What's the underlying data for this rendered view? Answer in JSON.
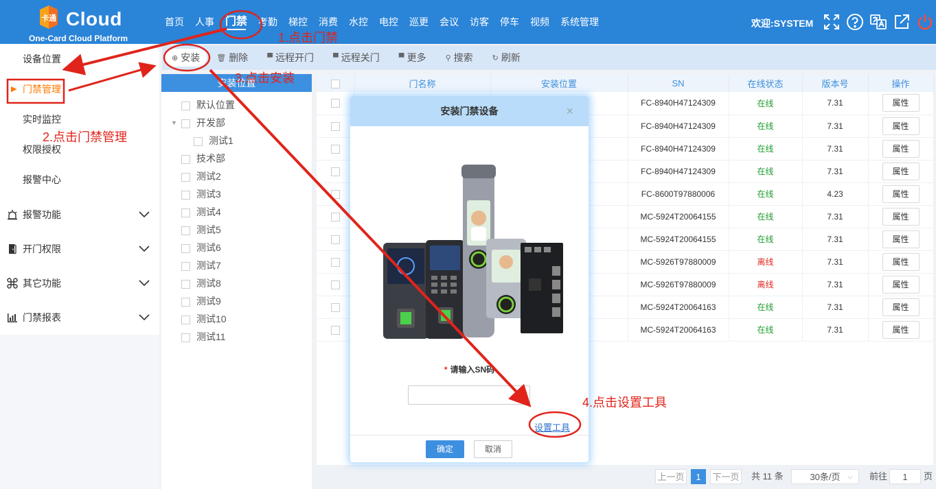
{
  "brand": {
    "word": "Cloud",
    "subtitle": "One-Card Cloud Platform",
    "mark_text": "卡通"
  },
  "nav": [
    {
      "label": "首页"
    },
    {
      "label": "人事"
    },
    {
      "label": "门禁",
      "active": true
    },
    {
      "label": "考勤"
    },
    {
      "label": "梯控"
    },
    {
      "label": "消费"
    },
    {
      "label": "水控"
    },
    {
      "label": "电控"
    },
    {
      "label": "巡更"
    },
    {
      "label": "会议"
    },
    {
      "label": "访客"
    },
    {
      "label": "停车"
    },
    {
      "label": "视频"
    },
    {
      "label": "系统管理"
    }
  ],
  "header": {
    "welcome": "欢迎:SYSTEM"
  },
  "sidebar": {
    "items": [
      {
        "label": "设备位置"
      },
      {
        "label": "门禁管理",
        "active": true
      },
      {
        "label": "实时监控"
      },
      {
        "label": "权限授权"
      },
      {
        "label": "报警中心"
      }
    ],
    "groups": [
      {
        "label": "报警功能",
        "icon": "alarm-icon"
      },
      {
        "label": "开门权限",
        "icon": "door-icon"
      },
      {
        "label": "其它功能",
        "icon": "command-icon"
      },
      {
        "label": "门禁报表",
        "icon": "report-icon"
      }
    ]
  },
  "toolbar": {
    "install": "安装",
    "delete": "删除",
    "remote_open": "远程开门",
    "remote_close": "远程关门",
    "more": "更多",
    "search": "搜索",
    "refresh": "刷新"
  },
  "tree": {
    "header": "安装位置",
    "nodes": [
      {
        "label": "默认位置",
        "level": 0
      },
      {
        "label": "开发部",
        "level": 0,
        "expanded": true
      },
      {
        "label": "测试1",
        "level": 1
      },
      {
        "label": "技术部",
        "level": 0
      },
      {
        "label": "测试2",
        "level": 0
      },
      {
        "label": "测试3",
        "level": 0
      },
      {
        "label": "测试4",
        "level": 0
      },
      {
        "label": "测试5",
        "level": 0
      },
      {
        "label": "测试6",
        "level": 0
      },
      {
        "label": "测试7",
        "level": 0
      },
      {
        "label": "测试8",
        "level": 0
      },
      {
        "label": "测试9",
        "level": 0
      },
      {
        "label": "测试10",
        "level": 0
      },
      {
        "label": "测试11",
        "level": 0
      }
    ]
  },
  "table": {
    "columns": [
      "门名称",
      "安装位置",
      "SN",
      "在线状态",
      "版本号",
      "操作"
    ],
    "action_label": "属性",
    "rows": [
      {
        "sn": "FC-8940H47124309",
        "status": "在线",
        "online": true,
        "version": "7.31"
      },
      {
        "sn": "FC-8940H47124309",
        "status": "在线",
        "online": true,
        "version": "7.31"
      },
      {
        "sn": "FC-8940H47124309",
        "status": "在线",
        "online": true,
        "version": "7.31"
      },
      {
        "sn": "FC-8940H47124309",
        "status": "在线",
        "online": true,
        "version": "7.31"
      },
      {
        "sn": "FC-8600T97880006",
        "status": "在线",
        "online": true,
        "version": "4.23"
      },
      {
        "sn": "MC-5924T20064155",
        "status": "在线",
        "online": true,
        "version": "7.31"
      },
      {
        "sn": "MC-5924T20064155",
        "status": "在线",
        "online": true,
        "version": "7.31"
      },
      {
        "sn": "MC-5926T97880009",
        "status": "离线",
        "online": false,
        "version": "7.31"
      },
      {
        "sn": "MC-5926T97880009",
        "status": "离线",
        "online": false,
        "version": "7.31"
      },
      {
        "sn": "MC-5924T20064163",
        "status": "在线",
        "online": true,
        "version": "7.31"
      },
      {
        "sn": "MC-5924T20064163",
        "status": "在线",
        "online": true,
        "version": "7.31"
      }
    ]
  },
  "pagination": {
    "prev": "上一页",
    "current": "1",
    "next": "下一页",
    "total": "共 11 条",
    "page_size": "30条/页",
    "goto_label": "前往",
    "goto_value": "1",
    "page_unit": "页"
  },
  "modal": {
    "title": "安装门禁设备",
    "close": "×",
    "sn_label": "请输入SN码",
    "sn_required_mark": "*",
    "sn_value": "",
    "setting_tool": "设置工具",
    "ok": "确定",
    "cancel": "取消"
  },
  "annotations": {
    "step1": "1.点击门禁",
    "step2": "2.点击门禁管理",
    "step3": "3.点击安装",
    "step4": "4.点击设置工具"
  },
  "colors": {
    "header": "#2a84d8",
    "accent": "#3d8fe0",
    "active": "#ff7a00",
    "annotation": "#e0241b",
    "online": "#1c9c2c",
    "offline": "#e0281f"
  }
}
